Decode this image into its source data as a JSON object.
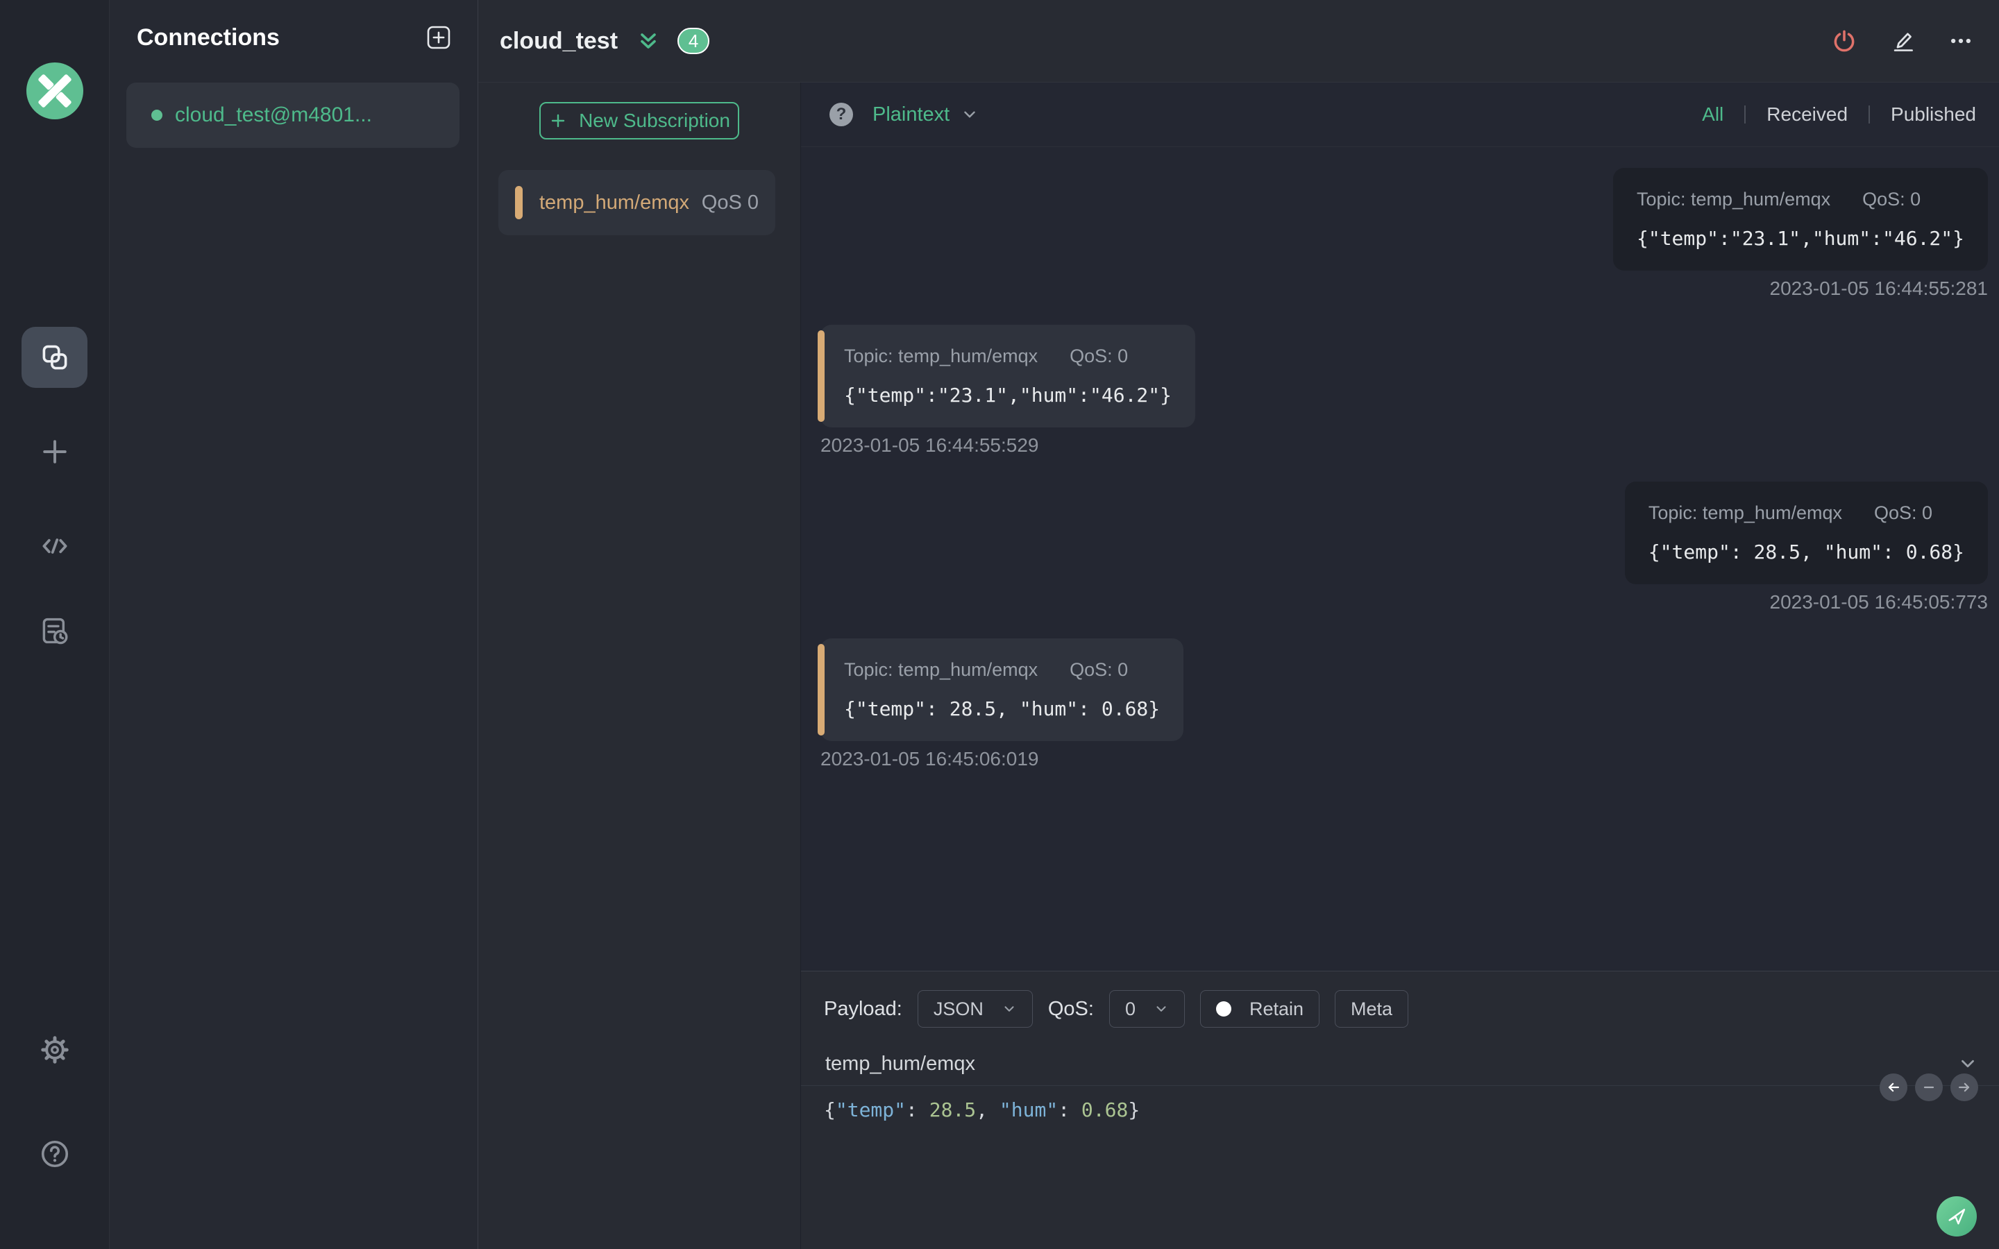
{
  "connections_panel": {
    "title": "Connections",
    "items": [
      {
        "label": "cloud_test@m4801...",
        "status": "connected",
        "status_color": "#5fbf92"
      }
    ]
  },
  "header": {
    "title": "cloud_test",
    "message_count_badge": "4"
  },
  "subscriptions": {
    "new_subscription_label": "New Subscription",
    "items": [
      {
        "topic": "temp_hum/emqx",
        "qos": "QoS 0",
        "marker_color": "#d8ab75"
      }
    ]
  },
  "message_view": {
    "help_glyph": "?",
    "format_selected": "Plaintext",
    "filters": {
      "all": "All",
      "received": "Received",
      "published": "Published",
      "active": "All"
    },
    "messages": [
      {
        "direction": "published",
        "topic_label": "Topic: temp_hum/emqx",
        "qos_label": "QoS: 0",
        "payload": "{\"temp\":\"23.1\",\"hum\":\"46.2\"}",
        "timestamp": "2023-01-05 16:44:55:281"
      },
      {
        "direction": "received",
        "topic_label": "Topic: temp_hum/emqx",
        "qos_label": "QoS: 0",
        "payload": "{\"temp\":\"23.1\",\"hum\":\"46.2\"}",
        "timestamp": "2023-01-05 16:44:55:529"
      },
      {
        "direction": "published",
        "topic_label": "Topic: temp_hum/emqx",
        "qos_label": "QoS: 0",
        "payload": "{\"temp\": 28.5, \"hum\": 0.68}",
        "timestamp": "2023-01-05 16:45:05:773"
      },
      {
        "direction": "received",
        "topic_label": "Topic: temp_hum/emqx",
        "qos_label": "QoS: 0",
        "payload": "{\"temp\": 28.5, \"hum\": 0.68}",
        "timestamp": "2023-01-05 16:45:06:019"
      }
    ]
  },
  "publish": {
    "payload_label": "Payload:",
    "format_value": "JSON",
    "qos_label": "QoS:",
    "qos_value": "0",
    "retain_label": "Retain",
    "meta_label": "Meta",
    "topic_value": "temp_hum/emqx",
    "payload_tokens": {
      "open_brace": "{",
      "key1": "\"temp\"",
      "colon1": ": ",
      "num1": "28.5",
      "comma": ", ",
      "key2": "\"hum\"",
      "colon2": ": ",
      "num2": "0.68",
      "close_brace": "}"
    }
  },
  "accent_colors": {
    "green": "#4eba8b",
    "badge_green": "#5fbf92",
    "subscription_marker": "#d8ab75",
    "disconnect_red": "#e0726a"
  }
}
